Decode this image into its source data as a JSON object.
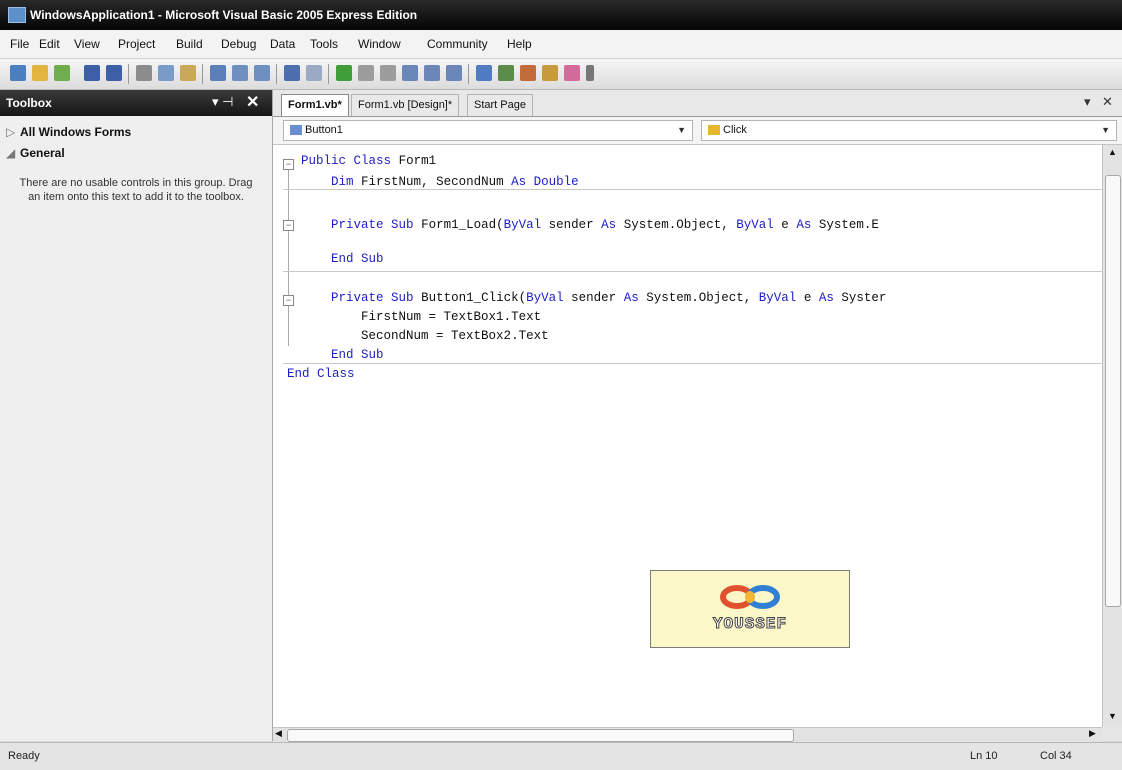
{
  "window": {
    "title": "WindowsApplication1 - Microsoft Visual Basic 2005 Express Edition"
  },
  "menu": {
    "items": [
      "File",
      "Edit",
      "View",
      "Project",
      "Build",
      "Debug",
      "Data",
      "Tools",
      "Window",
      "Community",
      "Help"
    ]
  },
  "toolbox": {
    "title": "Toolbox",
    "pin_icon": "pin-icon",
    "close_icon": "close-icon",
    "sections": [
      {
        "label": "All Windows Forms",
        "state": "collapsed"
      },
      {
        "label": "General",
        "state": "expanded"
      }
    ],
    "empty_message": "There are no usable controls in this group. Drag an item onto this text to add it to the toolbox."
  },
  "tabs": [
    {
      "label": "Form1.vb*",
      "active": true
    },
    {
      "label": "Form1.vb [Design]*",
      "active": false
    },
    {
      "label": "Start Page",
      "active": false
    }
  ],
  "navbar": {
    "object_combo": "Button1",
    "event_combo": "Click"
  },
  "code": {
    "lines": [
      "Public Class Form1",
      "    Dim FirstNum, SecondNum As Double",
      "    Private Sub Form1_Load(ByVal sender As System.Object, ByVal e As System.E",
      "    End Sub",
      "    Private Sub Button1_Click(ByVal sender As System.Object, ByVal e As Syster",
      "        FirstNum = TextBox1.Text",
      "        SecondNum = TextBox2.Text",
      "    End Sub",
      "End Class"
    ]
  },
  "logo": {
    "text": "YOUSSEF"
  },
  "status": {
    "ready": "Ready",
    "line": "Ln 10",
    "col": "Col 34"
  },
  "colors": {
    "keyword": "#1d1dc8",
    "titlebar": "#0a0a0a",
    "logo_bg": "#fcf7c9"
  }
}
